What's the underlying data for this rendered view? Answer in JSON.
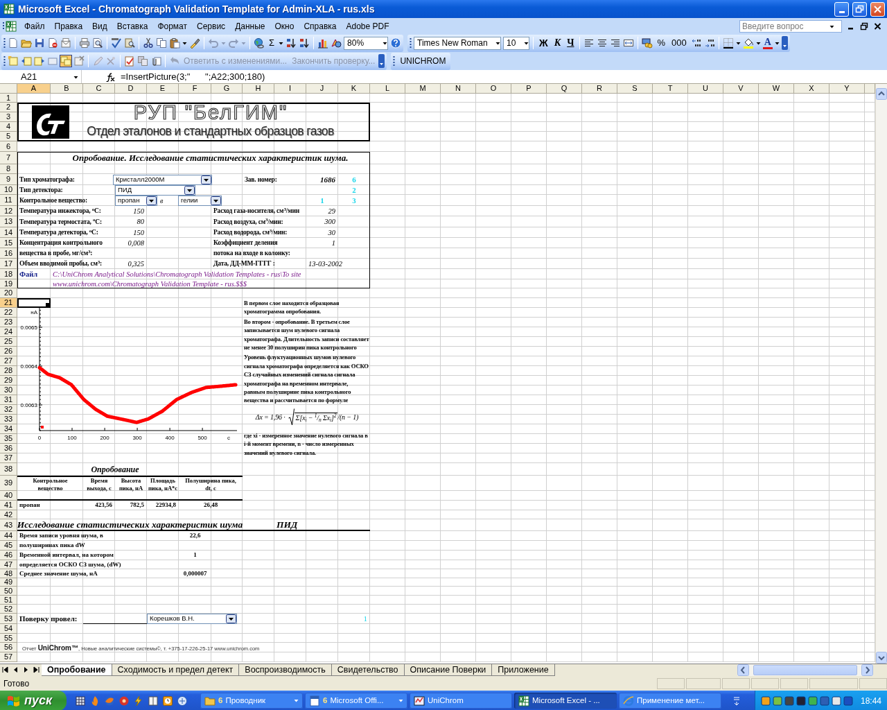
{
  "window": {
    "title": "Microsoft Excel - Chromatograph Validation Template for Admin-XLA - rus.xls"
  },
  "menu": [
    "Файл",
    "Правка",
    "Вид",
    "Вставка",
    "Формат",
    "Сервис",
    "Данные",
    "Окно",
    "Справка",
    "Adobe PDF"
  ],
  "help_box": {
    "placeholder": "Введите вопрос"
  },
  "standard_toolbar": {
    "sum": "Σ",
    "zoom": "80%"
  },
  "formatting_toolbar": {
    "font": "Times New Roman",
    "size": "10",
    "bold": "Ж",
    "italic": "К",
    "underline": "Ч",
    "percent": "%",
    "thousands": "000",
    "font_color": "A"
  },
  "reviewing_toolbar": {
    "show_all_comments": {
      "on": true
    },
    "items": [
      {
        "label": "Ответить с изменениями...",
        "disabled": true
      },
      {
        "label": "Закончить проверку...",
        "disabled": true
      }
    ],
    "custom_button": "UNICHROM"
  },
  "formula_bar": {
    "name_box": "A21",
    "formula": "=InsertPicture(3;\"      \";A22;300;180)"
  },
  "columns": [
    {
      "label": "A",
      "selected": true
    },
    {
      "label": "B",
      "selected": false
    },
    {
      "label": "C",
      "selected": false
    },
    {
      "label": "D",
      "selected": false
    },
    {
      "label": "E",
      "selected": false
    },
    {
      "label": "F",
      "selected": false
    },
    {
      "label": "G",
      "selected": false
    },
    {
      "label": "H",
      "selected": false
    },
    {
      "label": "I",
      "selected": false
    },
    {
      "label": "J",
      "selected": false
    },
    {
      "label": "K",
      "selected": false
    },
    {
      "label": "L",
      "selected": false
    },
    {
      "label": "M",
      "selected": false
    },
    {
      "label": "N",
      "selected": false
    },
    {
      "label": "O",
      "selected": false
    },
    {
      "label": "P",
      "selected": false
    },
    {
      "label": "Q",
      "selected": false
    },
    {
      "label": "R",
      "selected": false
    },
    {
      "label": "S",
      "selected": false
    },
    {
      "label": "T",
      "selected": false
    },
    {
      "label": "U",
      "selected": false
    },
    {
      "label": "V",
      "selected": false
    },
    {
      "label": "W",
      "selected": false
    },
    {
      "label": "X",
      "selected": false
    },
    {
      "label": "Y",
      "selected": false
    }
  ],
  "rows": [
    {
      "label": "1",
      "selected": false
    },
    {
      "label": "2",
      "selected": false
    },
    {
      "label": "3",
      "selected": false
    },
    {
      "label": "4",
      "selected": false
    },
    {
      "label": "5",
      "selected": false
    },
    {
      "label": "6",
      "selected": false
    },
    {
      "label": "7",
      "selected": false
    },
    {
      "label": "8",
      "selected": false
    },
    {
      "label": "9",
      "selected": false
    },
    {
      "label": "10",
      "selected": false
    },
    {
      "label": "11",
      "selected": false
    },
    {
      "label": "12",
      "selected": false
    },
    {
      "label": "13",
      "selected": false
    },
    {
      "label": "14",
      "selected": false
    },
    {
      "label": "15",
      "selected": false
    },
    {
      "label": "16",
      "selected": false
    },
    {
      "label": "17",
      "selected": false
    },
    {
      "label": "18",
      "selected": false
    },
    {
      "label": "19",
      "selected": false
    },
    {
      "label": "20",
      "selected": false
    },
    {
      "label": "21",
      "selected": true
    },
    {
      "label": "22",
      "selected": false
    },
    {
      "label": "23",
      "selected": false
    },
    {
      "label": "24",
      "selected": false
    },
    {
      "label": "25",
      "selected": false
    },
    {
      "label": "26",
      "selected": false
    },
    {
      "label": "27",
      "selected": false
    },
    {
      "label": "28",
      "selected": false
    },
    {
      "label": "29",
      "selected": false
    },
    {
      "label": "30",
      "selected": false
    },
    {
      "label": "31",
      "selected": false
    },
    {
      "label": "32",
      "selected": false
    },
    {
      "label": "33",
      "selected": false
    },
    {
      "label": "34",
      "selected": false
    },
    {
      "label": "35",
      "selected": false
    },
    {
      "label": "36",
      "selected": false
    },
    {
      "label": "37",
      "selected": false
    },
    {
      "label": "38",
      "selected": false
    },
    {
      "label": "39",
      "selected": false
    },
    {
      "label": "40",
      "selected": false
    },
    {
      "label": "41",
      "selected": false
    },
    {
      "label": "42",
      "selected": false
    },
    {
      "label": "43",
      "selected": false
    },
    {
      "label": "44",
      "selected": false
    },
    {
      "label": "45",
      "selected": false
    },
    {
      "label": "46",
      "selected": false
    },
    {
      "label": "47",
      "selected": false
    },
    {
      "label": "48",
      "selected": false
    },
    {
      "label": "49",
      "selected": false
    },
    {
      "label": "50",
      "selected": false
    },
    {
      "label": "51",
      "selected": false
    },
    {
      "label": "52",
      "selected": false
    },
    {
      "label": "53",
      "selected": false
    },
    {
      "label": "54",
      "selected": false
    },
    {
      "label": "55",
      "selected": false
    },
    {
      "label": "56",
      "selected": false
    },
    {
      "label": "57",
      "selected": false
    }
  ],
  "header": {
    "organization": "РУП \"БелГИМ\"",
    "department": "Отдел эталонов и стандартных образцов газов"
  },
  "form": {
    "title": "Опробование.  Исследование статистических характеристик шума.",
    "cells": [
      "Тип хроматографа:",
      "Зав. номер:",
      "1686",
      "6",
      "Тип детектора:",
      "2",
      "Контрольное вещество:",
      "в",
      "1",
      "3",
      "Температура инжектора, $^{o}$C:",
      "150",
      "Расход газа-носителя, см$^{3}$/мин",
      "29",
      "Температура термостата, $^{o}$C:",
      "80",
      "Расход воздуха, см$^{3}$/мин:",
      "300",
      "Температура детектора, $^{o}$C:",
      "150",
      "Расход водорода, см$^{3}$/мин:",
      "30",
      "Концентрация контрольного",
      "0,008",
      "Коэффициент деления",
      "1",
      "вещества в пробе, мг/см$^{3}$:",
      "потока на входе в колонку:",
      "Объем вводимой пробы, см$^{3}$:",
      "0,325",
      "Дата, ДД-ММ-ГГГГ :",
      "13-03-2002",
      "Файл",
      "C:\\UniChrom Analytical Solutions\\Chromatograph Validation Templates - rus\\To site",
      "www.unichrom.com\\Chromatograph Validation Template - rus.$$$"
    ],
    "dropdowns": [
      {
        "value": "Кристалл2000М"
      },
      {
        "value": "ПИД"
      },
      {
        "value": "пропан"
      },
      {
        "value": "гелии"
      }
    ]
  },
  "chart": {
    "chart_data": {
      "type": "line",
      "xlabel": "c",
      "ylabel": "нА",
      "x": [
        0,
        26,
        62,
        98,
        136,
        172,
        208,
        260,
        298,
        334,
        377,
        421,
        466,
        511,
        553,
        602
      ],
      "series": [
        {
          "color": "#ff0000",
          "values": [
            0.006396,
            0.006379,
            0.00637,
            0.006352,
            0.006314,
            0.006289,
            0.006271,
            0.006262,
            0.006255,
            0.006264,
            0.006284,
            0.006314,
            0.006332,
            0.006345,
            0.006348,
            0.006352
          ]
        }
      ],
      "xlim": [
        0,
        606
      ],
      "ylim": [
        0.006234,
        0.00655
      ],
      "xticks": [
        0,
        100,
        200,
        300,
        400,
        500
      ],
      "yticks": [
        0.0063,
        0.0064,
        0.0065
      ]
    }
  },
  "notes": {
    "paragraphs": [
      "В первом слое находится образцовая хроматограмма опробования.",
      "Во втором - опробование. В третьем слое записывается шум нулевого сигнала хроматографа. Длительность записи составляет не менее 30 полуширин пика контрольного",
      "Уровень флуктуационных шумов нулевого сигнала хроматографа определяется как ОСКО СЗ случайных изменений сигнала сигнала хроматографа на временном интервале, равным полуширине пика контрольного вещества и рассчитывается по формуле"
    ],
    "formula": {
      "lhs": "Δx = 1,96 ·",
      "radicand": "Σ[x$_{i}$ − $^{1}$/$_{n}$ Σx$_{i}$]$^{2}$",
      "tail": "/(n − 1)"
    },
    "remark": "где xi - измеренное значение нулевого сигнала в i-й момент времени, n - число измеренных значений нулевого сигнала."
  },
  "sampling_table": {
    "title": "Опробование",
    "columns": [
      "Контрольное вещество",
      "Время выхода, с",
      "Высота пика, нА",
      "Площадь пика, нА*с",
      "Полуширина пика, dt, с"
    ],
    "rows": [
      [
        "пропан",
        "423,56",
        "782,5",
        "22934,8",
        "26,48"
      ]
    ]
  },
  "noise": {
    "title": "Исследование статистических характеристик шума",
    "detector": "ПИД",
    "fields": [
      {
        "lines": [
          "Время записи уровня шума, в",
          "полуширинах пика  dW"
        ],
        "value": "22,6"
      },
      {
        "lines": [
          "Временной интервал, на котором",
          "определяется ОСКО СЗ шума, (dW)"
        ],
        "value": "1"
      },
      {
        "lines": [
          "Среднее значение шума, нА"
        ],
        "value": "0,000007"
      }
    ]
  },
  "signoff": {
    "label": "Поверку провел:",
    "dropdown": "Корешков В.Н.",
    "marker": "1"
  },
  "footer": "Отчет  **UniChrom™**, Новые аналитические системы©, т. +375-17-226-25-17 www.unichrom.com",
  "sheet_tabs": [
    {
      "label": "Опробование",
      "selected": true
    },
    {
      "label": "Сходимость и предел детект",
      "selected": false
    },
    {
      "label": "Воспроизводимость",
      "selected": false
    },
    {
      "label": "Свидетельство",
      "selected": false
    },
    {
      "label": "Описание Поверки",
      "selected": false
    },
    {
      "label": "Приложение",
      "selected": false
    }
  ],
  "status_bar": {
    "text": "Готово"
  },
  "taskbar": {
    "start": "пуск",
    "tasks": [
      {
        "count": "6",
        "label": "Проводник",
        "selected": false,
        "kind": "group"
      },
      {
        "count": "6",
        "label": "Microsoft Offi...",
        "selected": false,
        "kind": "group"
      },
      {
        "label": "UniChrom",
        "selected": false,
        "kind": "single"
      },
      {
        "label": "Microsoft Excel - ...",
        "selected": true,
        "kind": "single"
      },
      {
        "label": "Применение мет...",
        "selected": false,
        "kind": "single"
      }
    ],
    "clock": "18:44"
  }
}
